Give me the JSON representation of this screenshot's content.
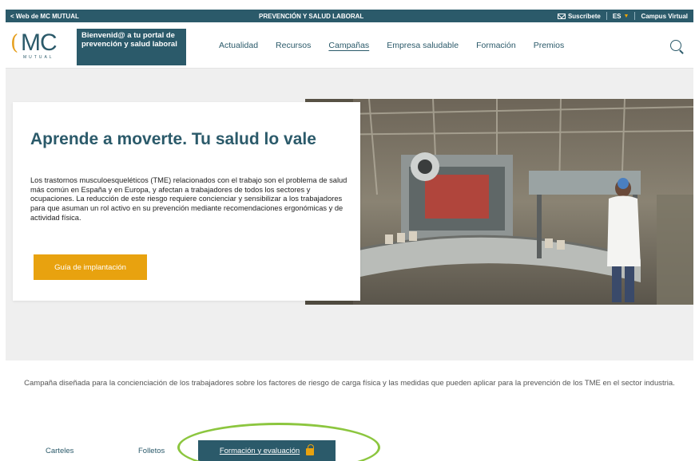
{
  "top_bar": {
    "back_link": "< Web de MC MUTUAL",
    "center_title": "PREVENCIÓN Y SALUD LABORAL",
    "subscribe": "Suscríbete",
    "language": "ES",
    "campus": "Campus Virtual"
  },
  "header": {
    "logo_text": "MC",
    "logo_sub": "MUTUAL",
    "welcome": "Bienvenid@ a tu portal de prevención y salud laboral",
    "nav": [
      "Actualidad",
      "Recursos",
      "Campañas",
      "Empresa saludable",
      "Formación",
      "Premios"
    ],
    "active_nav": "Campañas"
  },
  "hero": {
    "title": "Aprende a moverte. Tu salud lo vale",
    "text": "Los trastornos musculoesqueléticos (TME) relacionados con el trabajo son el problema de salud más común en España y en Europa, y afectan a trabajadores de todos los sectores y ocupaciones. La reducción de este riesgo requiere concienciar y sensibilizar a los trabajadores para que asuman un rol activo en su prevención mediante recomendaciones ergonómicas y de actividad física.",
    "cta": "Guía de implantación"
  },
  "description": "Campaña diseñada para la concienciación de los trabajadores sobre los factores de riesgo de carga física y las medidas que pueden aplicar para la prevención de los TME en el sector industria.",
  "tabs": {
    "items": [
      "Carteles",
      "Folletos"
    ],
    "active": "Formación y evaluación"
  },
  "colors": {
    "brand": "#2b5a6a",
    "accent": "#e8a20f",
    "highlight": "#8cc63f"
  }
}
